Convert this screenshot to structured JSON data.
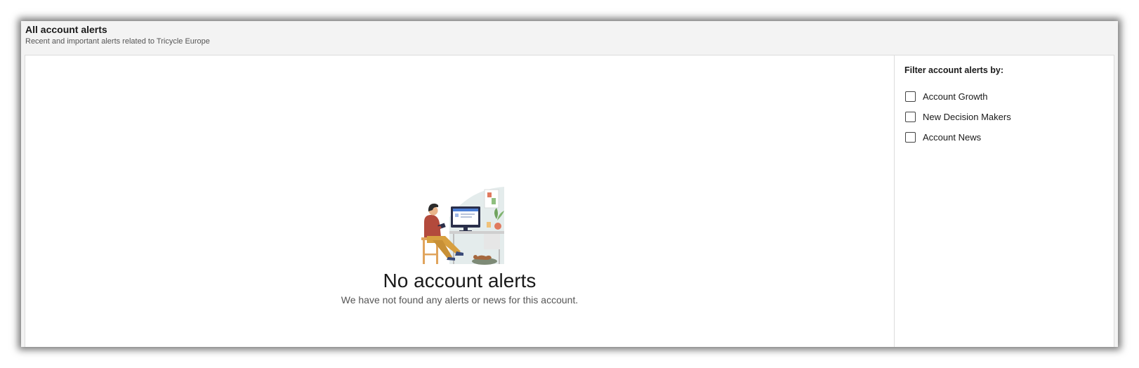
{
  "header": {
    "title": "All account alerts",
    "subtitle": "Recent and important alerts related to Tricycle Europe"
  },
  "empty_state": {
    "illustration": "person-at-desk-illustration",
    "title": "No account alerts",
    "message": "We have not found any alerts or news for this account."
  },
  "filters": {
    "title": "Filter account alerts by:",
    "items": [
      {
        "label": "Account Growth",
        "checked": false
      },
      {
        "label": "New Decision Makers",
        "checked": false
      },
      {
        "label": "Account News",
        "checked": false
      }
    ]
  }
}
